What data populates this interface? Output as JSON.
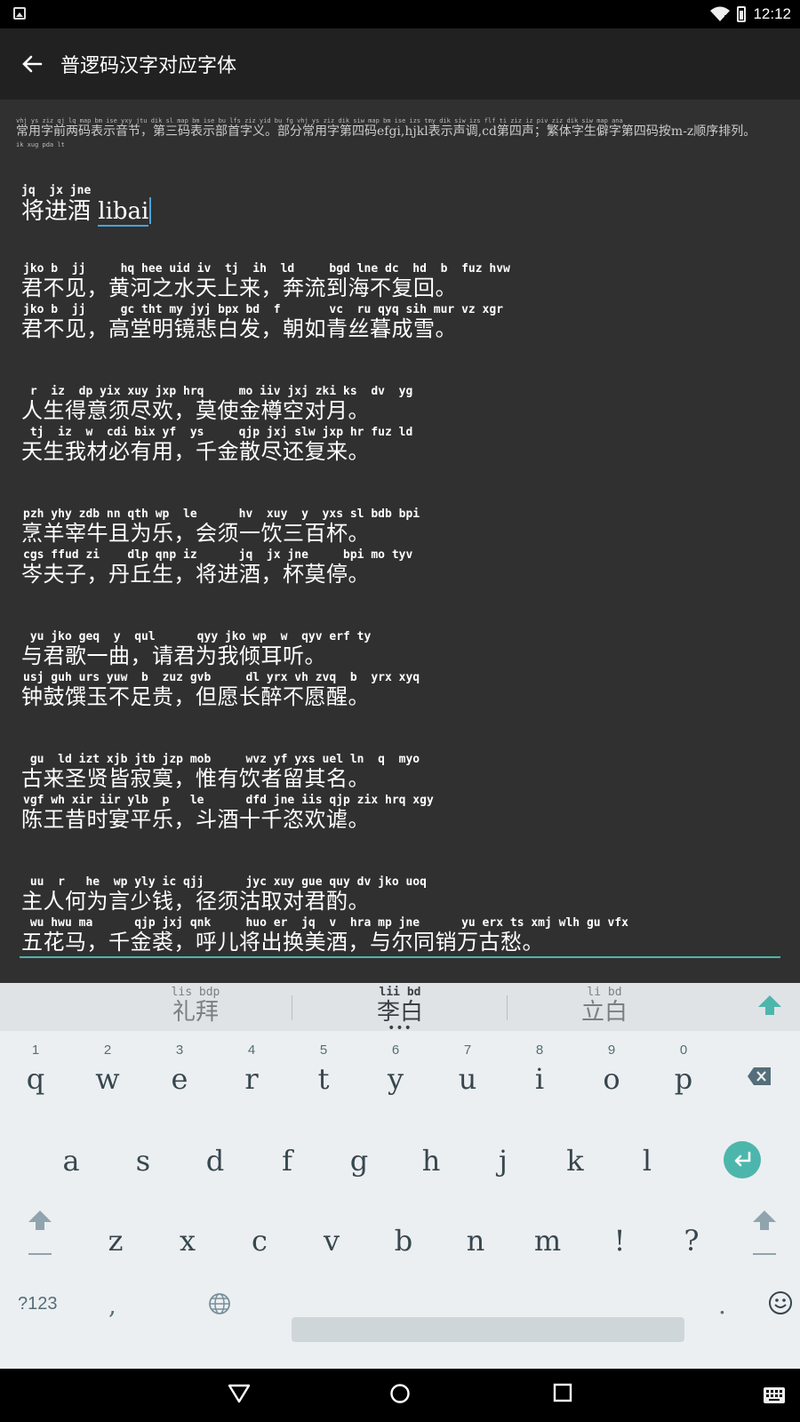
{
  "status_bar": {
    "time": "12:12"
  },
  "app_bar": {
    "title": "普逻码汉字对应字体"
  },
  "description": {
    "codes": "vhj ys ziz qj lq map bm ise yxy jtu    dik sl map bm ise bu lfs ziz yid     bu fg vhj ys ziz dik siw map                         bm ise izs tmy       dik siw izs   flf ti ziz iz piv ziz dik siw map ana",
    "text": "常用字前两码表示音节，第三码表示部首字义。部分常用字第四码efgi,hjkl表示声调,cd第四声；繁体字生僻字第四码按m-z顺序排列。",
    "tail_codes": "ik xug pda lt"
  },
  "editor": {
    "title_annotation": "jq  jx jne",
    "title_text": "将进酒",
    "title_latin": "libai",
    "lines": [
      {
        "annotation": "jko b  jj     hq hee uid iv  tj  ih  ld     bgd lne dc  hd  b  fuz hvw",
        "text": "君不见，黄河之水天上来，奔流到海不复回。"
      },
      {
        "annotation": "jko b  jj     gc tht my jyj bpx bd  f       vc  ru qyq sih mur vz xgr",
        "text": "君不见，高堂明镜悲白发，朝如青丝暮成雪。"
      },
      {
        "annotation": " r  iz  dp yix xuy jxp hrq     mo iiv jxj zki ks  dv  yg",
        "text": "人生得意须尽欢，莫使金樽空对月。"
      },
      {
        "annotation": " tj  iz  w  cdi bix yf  ys     qjp jxj slw jxp hr fuz ld",
        "text": "天生我材必有用，千金散尽还复来。"
      },
      {
        "annotation": "pzh yhy zdb nn qth wp  le      hv  xuy  y  yxs sl bdb bpi",
        "text": "烹羊宰牛且为乐，会须一饮三百杯。"
      },
      {
        "annotation": "cgs ffud zi    dlp qnp iz      jq  jx jne     bpi mo tyv",
        "text": "岑夫子，丹丘生，将进酒，杯莫停。"
      },
      {
        "annotation": " yu jko geq  y  qul      qyy jko wp  w  qyv erf ty",
        "text": "与君歌一曲，请君为我倾耳听。"
      },
      {
        "annotation": "usj guh urs yuw  b  zuz gvb     dl yrx vh zvq  b  yrx xyq",
        "text": "钟鼓馔玉不足贵，但愿长醉不愿醒。"
      },
      {
        "annotation": " gu  ld izt xjb jtb jzp mob     wvz yf yxs uel ln  q  myo",
        "text": "古来圣贤皆寂寞，惟有饮者留其名。"
      },
      {
        "annotation": "vgf wh xir iir ylb  p   le      dfd jne iis qjp zix hrq xgy",
        "text": "陈王昔时宴平乐，斗酒十千恣欢谑。"
      },
      {
        "annotation": " uu  r   he  wp yly ic qjj      jyc xuy gue quy dv jko uoq",
        "text": "主人何为言少钱，径须沽取对君酌。"
      },
      {
        "annotation": " wu hwu ma      qjp jxj qnk     huo er  jq  v  hra mp jne      yu erx ts xmj wlh gu vfx",
        "text": "五花马，千金裘，呼儿将出换美酒，与尔同销万古愁。"
      }
    ]
  },
  "suggestions": [
    {
      "annotation": "lis bdp",
      "word": "礼拜"
    },
    {
      "annotation": "lii bd",
      "word": "李白",
      "more": "•••"
    },
    {
      "annotation": "li  bd",
      "word": "立白"
    }
  ],
  "keyboard": {
    "row1": [
      {
        "hint": "1",
        "key": "q"
      },
      {
        "hint": "2",
        "key": "w"
      },
      {
        "hint": "3",
        "key": "e"
      },
      {
        "hint": "4",
        "key": "r"
      },
      {
        "hint": "5",
        "key": "t"
      },
      {
        "hint": "6",
        "key": "y"
      },
      {
        "hint": "7",
        "key": "u"
      },
      {
        "hint": "8",
        "key": "i"
      },
      {
        "hint": "9",
        "key": "o"
      },
      {
        "hint": "0",
        "key": "p"
      }
    ],
    "row2": [
      "a",
      "s",
      "d",
      "f",
      "g",
      "h",
      "j",
      "k",
      "l"
    ],
    "row3": [
      "z",
      "x",
      "c",
      "v",
      "b",
      "n",
      "m",
      "!",
      "?"
    ],
    "bottom": {
      "symbols": "?123",
      "comma": ",",
      "period": "."
    }
  },
  "colors": {
    "accent": "#4db6ac",
    "cursor": "#4aa3d6",
    "content_bg": "#303030",
    "appbar_bg": "#212121",
    "keyboard_bg": "#eceff1"
  }
}
